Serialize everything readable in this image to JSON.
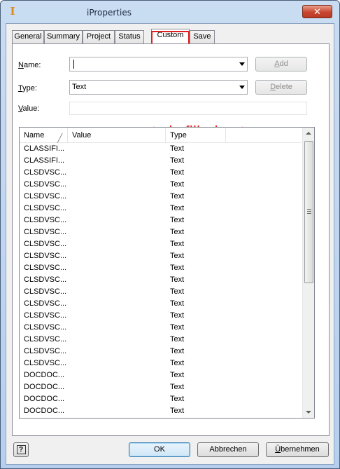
{
  "window": {
    "title": "iProperties",
    "close_label": "✕",
    "app_icon_glyph": "I"
  },
  "tabs": [
    {
      "label": "General"
    },
    {
      "label": "Summary"
    },
    {
      "label": "Project"
    },
    {
      "label": "Status"
    },
    {
      "label": "Custom"
    },
    {
      "label": "Save"
    }
  ],
  "active_tab": "Custom",
  "form": {
    "name_label_key": "N",
    "name_label_rest": "ame:",
    "name_value": "",
    "type_label_key": "T",
    "type_label_rest": "ype:",
    "type_value": "Text",
    "value_label_key": "V",
    "value_label_rest": "alue:",
    "value_value": "",
    "add_key": "A",
    "add_rest": "dd",
    "delete_key": "D",
    "delete_rest": "elete"
  },
  "annotation": "every property is filled out",
  "list": {
    "columns": [
      "Name",
      "Value",
      "Type"
    ],
    "rows": [
      {
        "name": "CLASSIFI...",
        "value": "",
        "type": "Text"
      },
      {
        "name": "CLASSIFI...",
        "value": "",
        "type": "Text"
      },
      {
        "name": "CLSDVSC...",
        "value": "",
        "type": "Text"
      },
      {
        "name": "CLSDVSC...",
        "value": "",
        "type": "Text"
      },
      {
        "name": "CLSDVSC...",
        "value": "",
        "type": "Text"
      },
      {
        "name": "CLSDVSC...",
        "value": "",
        "type": "Text"
      },
      {
        "name": "CLSDVSC...",
        "value": "",
        "type": "Text"
      },
      {
        "name": "CLSDVSC...",
        "value": "",
        "type": "Text"
      },
      {
        "name": "CLSDVSC...",
        "value": "",
        "type": "Text"
      },
      {
        "name": "CLSDVSC...",
        "value": "",
        "type": "Text"
      },
      {
        "name": "CLSDVSC...",
        "value": "",
        "type": "Text"
      },
      {
        "name": "CLSDVSC...",
        "value": "",
        "type": "Text"
      },
      {
        "name": "CLSDVSC...",
        "value": "",
        "type": "Text"
      },
      {
        "name": "CLSDVSC...",
        "value": "",
        "type": "Text"
      },
      {
        "name": "CLSDVSC...",
        "value": "",
        "type": "Text"
      },
      {
        "name": "CLSDVSC...",
        "value": "",
        "type": "Text"
      },
      {
        "name": "CLSDVSC...",
        "value": "",
        "type": "Text"
      },
      {
        "name": "CLSDVSC...",
        "value": "",
        "type": "Text"
      },
      {
        "name": "CLSDVSC...",
        "value": "",
        "type": "Text"
      },
      {
        "name": "DOCDOC...",
        "value": "",
        "type": "Text"
      },
      {
        "name": "DOCDOC...",
        "value": "",
        "type": "Text"
      },
      {
        "name": "DOCDOC...",
        "value": "",
        "type": "Text"
      },
      {
        "name": "DOCDOC...",
        "value": "",
        "type": "Text"
      }
    ]
  },
  "buttons": {
    "help": "?",
    "ok": "OK",
    "cancel": "Abbrechen",
    "apply_key": "Ü",
    "apply_rest": "bernehmen"
  },
  "colors": {
    "annotation": "#e81e1e",
    "tab_highlight": "#e02020"
  },
  "icons": {
    "app": "inventor-app-icon",
    "close": "close-icon",
    "help": "help-icon",
    "sort": "sort-indicator-icon"
  }
}
